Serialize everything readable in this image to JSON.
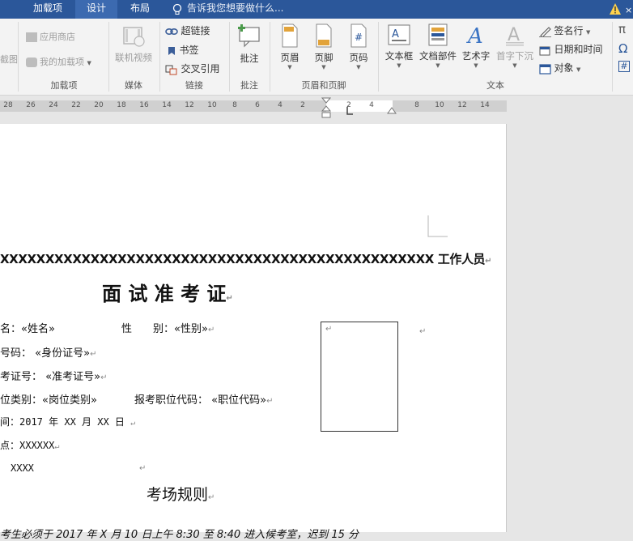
{
  "tabs": [
    {
      "label": "加载项"
    },
    {
      "label": "设计"
    },
    {
      "label": "布局"
    }
  ],
  "tellme": "告诉我您想要做什么...",
  "ribbon": {
    "addins": {
      "store": "应用商店",
      "my_addins": "我的加载项",
      "group": "加载项",
      "partial_left": "截图"
    },
    "media": {
      "online_video": "联机视频",
      "group": "媒体"
    },
    "links": {
      "hyperlink": "超链接",
      "bookmark": "书签",
      "cross_ref": "交叉引用",
      "group": "链接"
    },
    "comments": {
      "comment": "批注",
      "group": "批注"
    },
    "header_footer": {
      "header": "页眉",
      "footer": "页脚",
      "page_number": "页码",
      "group": "页眉和页脚"
    },
    "text": {
      "textbox": "文本框",
      "quick_parts": "文档部件",
      "wordart": "艺术字",
      "dropcap": "首字下沉",
      "signature": "签名行",
      "datetime": "日期和时间",
      "object": "对象",
      "group": "文本"
    }
  },
  "ruler": {
    "left_numbers": [
      "28",
      "26",
      "24",
      "22",
      "20",
      "18",
      "16",
      "14",
      "12",
      "10",
      "8",
      "6",
      "4",
      "2"
    ],
    "right_numbers": [
      "2",
      "4",
      "8",
      "10",
      "12",
      "14"
    ]
  },
  "document": {
    "top_line": "XXXXXXXXXXXXXXXXXXXXXXXXXXXXXXXXXXXXXXXXXXXXXXXX 工作人员",
    "title": "面 试 准 考 证",
    "name_label": "名：",
    "name_field": "«姓名»",
    "gender_label": "性　　别：",
    "gender_field": "«性别»",
    "id_label": "号码：",
    "id_field": "«身份证号»",
    "exam_label": "考证号：",
    "exam_field": "«准考证号»",
    "type_label": "位类别：",
    "type_field": "«岗位类别»",
    "code_label": "报考职位代码：",
    "code_field": "«职位代码»",
    "date_line": "间：2017 年 XX 月 XX 日",
    "place_line": "点：XXXXXX",
    "misc_line": "XXXX",
    "rules_title": "考场规则",
    "bottom_line": "考生必须于 2017 年 X 月 10 日上午 8:30 至 8:40 进入候考室，迟到 15 分"
  },
  "colors": {
    "accent": "#2b579a",
    "ribbon_bg": "#f3f3f3",
    "page_bg": "#ffffff",
    "workspace_bg": "#e6e6e6"
  }
}
